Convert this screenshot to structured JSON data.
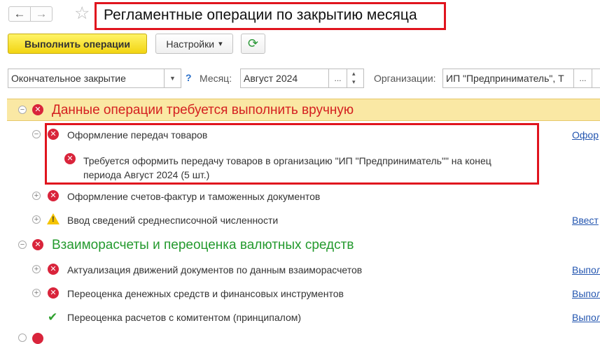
{
  "title": "Регламентные операции по закрытию месяца",
  "nav": {
    "back_icon": "←",
    "forward_icon": "→",
    "favorite_icon": "☆"
  },
  "toolbar": {
    "execute_label": "Выполнить операции",
    "settings_label": "Настройки",
    "settings_arrow": "▾",
    "refresh_icon": "⟳"
  },
  "filters": {
    "mode_value": "Окончательное закрытие",
    "mode_arrow": "▼",
    "help_label": "?",
    "month_label": "Месяц:",
    "month_value": "Август 2024",
    "select_btn": "...",
    "org_label": "Организации:",
    "org_value": "ИП \"Предприниматель\", Т"
  },
  "colors": {
    "accent_yellow": "#f2d412",
    "error_red": "#d9243b",
    "group_green": "#249a2e",
    "link_blue": "#2456b0"
  },
  "tree": {
    "group_manual": {
      "title": "Данные операции требуется выполнить вручную"
    },
    "item_transfer": {
      "title": "Оформление передач товаров",
      "link": "Офор",
      "message": "Требуется оформить передачу товаров в организацию \"ИП \"Предприниматель\"\" на конец периода Август 2024 (5 шт.)"
    },
    "item_invoices": {
      "title": "Оформление счетов-фактур и таможенных документов"
    },
    "item_headcount": {
      "title": "Ввод сведений среднесписочной численности",
      "link": "Ввест"
    },
    "group_settlements": {
      "title": "Взаиморасчеты и переоценка валютных средств"
    },
    "item_actualize": {
      "title": "Актуализация движений документов по данным взаиморасчетов",
      "link": "Выпол"
    },
    "item_revalue_cash": {
      "title": "Переоценка денежных средств и финансовых инструментов",
      "link": "Выпол"
    },
    "item_revalue_commit": {
      "title": "Переоценка расчетов с комитентом (принципалом)",
      "link": "Выпол"
    }
  }
}
